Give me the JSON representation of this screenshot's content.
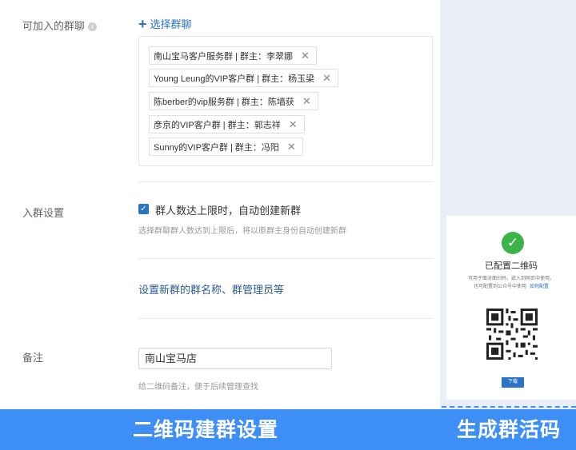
{
  "form": {
    "groups_label": "可加入的群聊",
    "add_group_label": "选择群聊",
    "groups": [
      {
        "name": "南山宝马客户服务群 | 群主：李翠娜"
      },
      {
        "name": "Young Leung的VIP客户群 | 群主：杨玉梁"
      },
      {
        "name": "陈berber的vip服务群 | 群主：陈墙获"
      },
      {
        "name": "彦京的VIP客户群 | 群主：郭志祥"
      },
      {
        "name": "Sunny的VIP客户群 | 群主：冯阳"
      }
    ],
    "join_settings_label": "入群设置",
    "auto_create_label": "群人数达上限时，自动创建新群",
    "auto_create_checked": true,
    "auto_create_hint": "选择群聊群人数达到上限后，将以原群主身份自动创建新群",
    "set_new_group_link": "设置新群的群名称、群管理员等",
    "remark_label": "备注",
    "remark_value": "南山宝马店",
    "remark_hint": "给二维码备注，便于后续管理查找"
  },
  "qr_card": {
    "title": "已配置二维码",
    "desc_line1": "可用于面对面扫码，嵌入到网页中使用，",
    "desc_line2": "也可配置到公众号中使用",
    "how_to_link": "如何配置",
    "download_label": "下载"
  },
  "footer": {
    "left_caption": "二维码建群设置",
    "right_caption": "生成群活码"
  },
  "colors": {
    "accent": "#2a73c7",
    "banner": "#3d8ff5",
    "success": "#3bb549"
  }
}
